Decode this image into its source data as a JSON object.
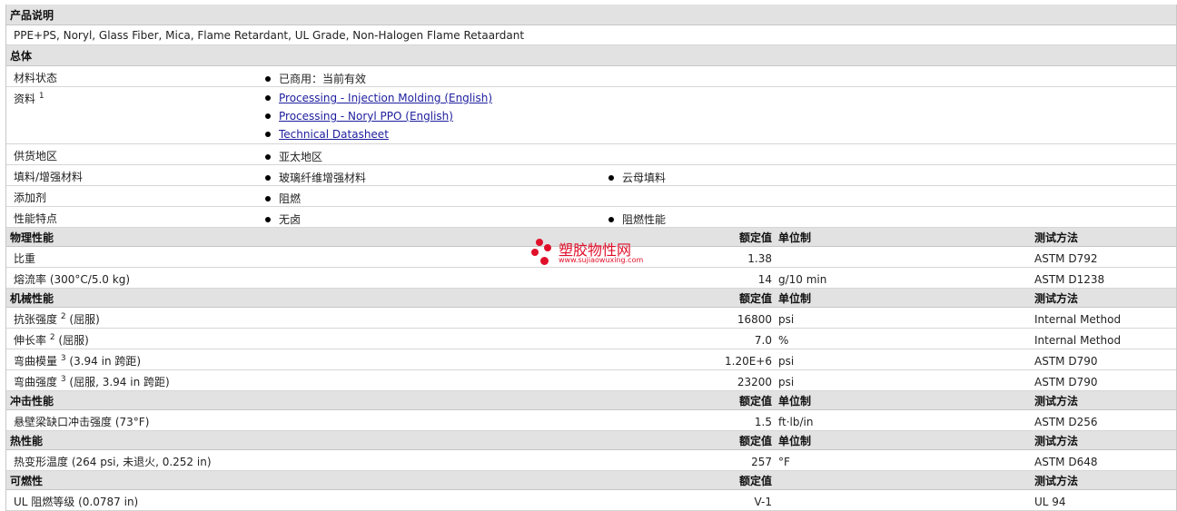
{
  "desc_header": "产品说明",
  "desc_text": "PPE+PS, Noryl, Glass Fiber, Mica, Flame Retardant, UL Grade, Non-Halogen Flame Retaardant",
  "general": {
    "header": "总体",
    "status": {
      "label": "材料状态",
      "value": "已商用：当前有效"
    },
    "docs": {
      "label": "资料",
      "sup": "1",
      "links": [
        "Processing - Injection Molding (English)",
        "Processing - Noryl PPO (English)",
        "Technical Datasheet"
      ]
    },
    "region": {
      "label": "供货地区",
      "value": "亚太地区"
    },
    "filler": {
      "label": "填料/增强材料",
      "values": [
        "玻璃纤维增强材料",
        "云母填料"
      ]
    },
    "additive": {
      "label": "添加剂",
      "value": "阻燃"
    },
    "features": {
      "label": "性能特点",
      "values": [
        "无卤",
        "阻燃性能"
      ]
    }
  },
  "columns": {
    "nominal": "额定值",
    "unit": "单位制",
    "test": "测试方法"
  },
  "sections": [
    {
      "title": "物理性能",
      "rows": [
        {
          "name": "比重",
          "sup": "",
          "note": "",
          "value": "1.38",
          "unit": "",
          "test": "ASTM D792"
        },
        {
          "name": "熔流率",
          "sup": "",
          "note": "(300°C/5.0 kg)",
          "value": "14",
          "unit": "g/10 min",
          "test": "ASTM D1238"
        }
      ]
    },
    {
      "title": "机械性能",
      "rows": [
        {
          "name": "抗张强度",
          "sup": "2",
          "note": "(屈服)",
          "value": "16800",
          "unit": "psi",
          "test": "Internal Method"
        },
        {
          "name": "伸长率",
          "sup": "2",
          "note": "(屈服)",
          "value": "7.0",
          "unit": "%",
          "test": "Internal Method"
        },
        {
          "name": "弯曲模量",
          "sup": "3",
          "note": "(3.94 in 跨距)",
          "value": "1.20E+6",
          "unit": "psi",
          "test": "ASTM D790"
        },
        {
          "name": "弯曲强度",
          "sup": "3",
          "note": "(屈服, 3.94 in 跨距)",
          "value": "23200",
          "unit": "psi",
          "test": "ASTM D790"
        }
      ]
    },
    {
      "title": "冲击性能",
      "rows": [
        {
          "name": "悬壁梁缺口冲击强度",
          "sup": "",
          "note": "(73°F)",
          "value": "1.5",
          "unit": "ft·lb/in",
          "test": "ASTM D256"
        }
      ]
    },
    {
      "title": "热性能",
      "rows": [
        {
          "name": "热变形温度",
          "sup": "",
          "note": "(264 psi, 未退火, 0.252 in)",
          "value": "257",
          "unit": "°F",
          "test": "ASTM D648"
        }
      ]
    },
    {
      "title": "可燃性",
      "show_unit": false,
      "rows": [
        {
          "name": "UL 阻燃等级",
          "sup": "",
          "note": "(0.0787 in)",
          "value": "V-1",
          "unit": "",
          "test": "UL 94"
        }
      ]
    }
  ],
  "watermark": {
    "name": "塑胶物性网",
    "url": "www.sujiaowuxing.com"
  }
}
